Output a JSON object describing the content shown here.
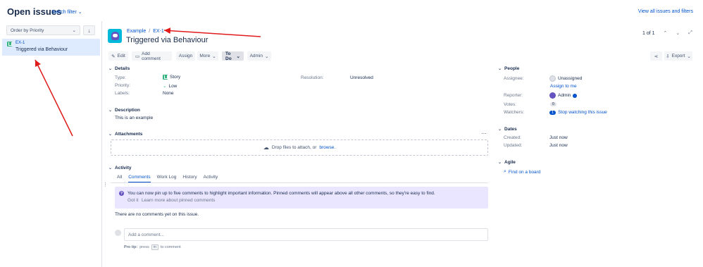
{
  "header": {
    "title": "Open issues",
    "switch_filter": "Switch filter",
    "view_all": "View all issues and filters"
  },
  "sidebar": {
    "order_by": "Order by Priority",
    "sort_icon": "↓",
    "issue": {
      "key": "EX-1",
      "summary": "Triggered via Behaviour"
    }
  },
  "issue": {
    "breadcrumb_project": "Example",
    "breadcrumb_key": "EX-1",
    "title": "Triggered via Behaviour",
    "pager": "1 of 1"
  },
  "toolbar": {
    "edit": "Edit",
    "add_comment": "Add comment",
    "assign": "Assign",
    "more": "More",
    "status": "To Do",
    "admin": "Admin",
    "export": "Export"
  },
  "details": {
    "heading": "Details",
    "type_label": "Type:",
    "type_value": "Story",
    "priority_label": "Priority:",
    "priority_value": "Low",
    "labels_label": "Labels:",
    "labels_value": "None",
    "resolution_label": "Resolution:",
    "resolution_value": "Unresolved"
  },
  "description": {
    "heading": "Description",
    "text": "This is an example"
  },
  "attachments": {
    "heading": "Attachments",
    "drop_text": "Drop files to attach, or",
    "browse": "browse."
  },
  "activity": {
    "heading": "Activity",
    "tabs": [
      "All",
      "Comments",
      "Work Log",
      "History",
      "Activity"
    ],
    "info_text": "You can now pin up to five comments to highlight important information. Pinned comments will appear above all other comments, so they're easy to find.",
    "got_it": "Got it",
    "learn_more": "Learn more about pinned comments",
    "no_comments": "There are no comments yet on this issue.",
    "add_comment_placeholder": "Add a comment...",
    "pro_tip_label": "Pro tip:",
    "pro_tip_press": "press",
    "pro_tip_key": "m",
    "pro_tip_end": "to comment"
  },
  "people": {
    "heading": "People",
    "assignee_label": "Assignee:",
    "assignee_value": "Unassigned",
    "assign_to_me": "Assign to me",
    "reporter_label": "Reporter:",
    "reporter_value": "Admin",
    "votes_label": "Votes:",
    "votes_value": "0",
    "watchers_label": "Watchers:",
    "watchers_count": "1",
    "watchers_link": "Stop watching this issue"
  },
  "dates": {
    "heading": "Dates",
    "created_label": "Created:",
    "created_value": "Just now",
    "updated_label": "Updated:",
    "updated_value": "Just now"
  },
  "agile": {
    "heading": "Agile",
    "find_board": "Find on a board"
  },
  "colors": {
    "accent": "#0052cc",
    "annotation_arrow": "#e01b1b",
    "selected_row": "#deebff",
    "info_bg": "#eae6ff"
  }
}
